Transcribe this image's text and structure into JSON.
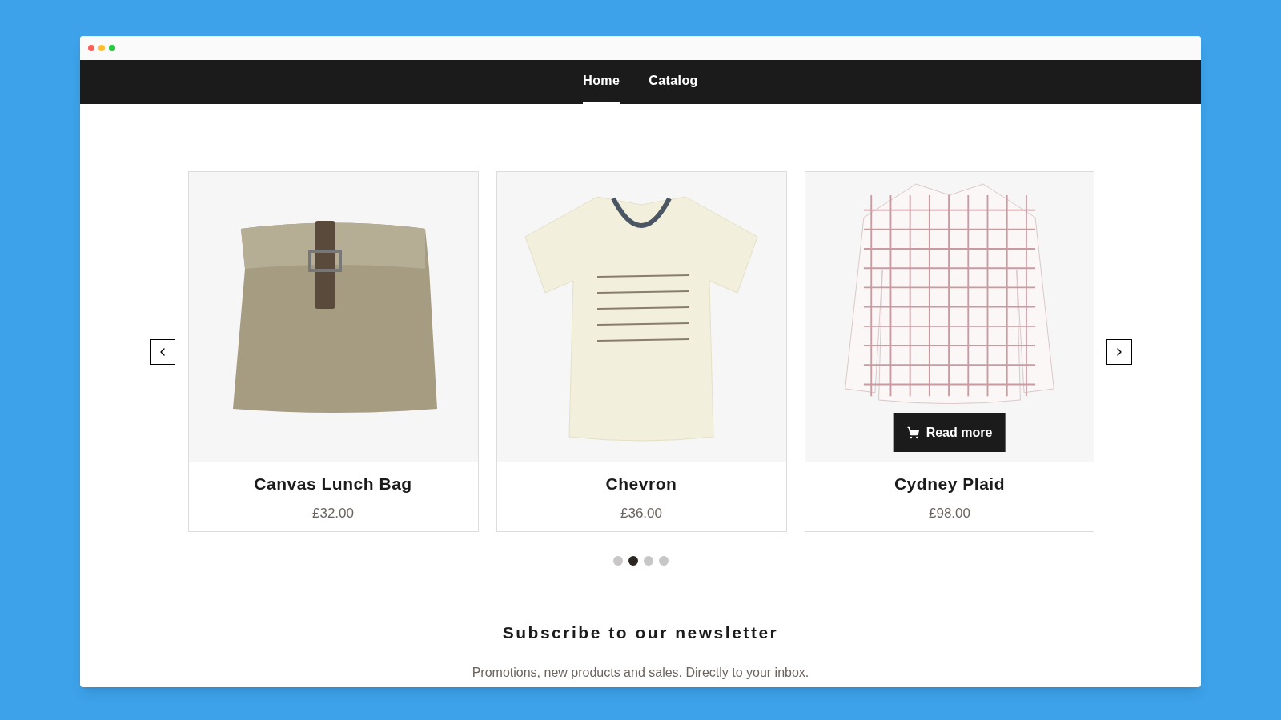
{
  "nav": [
    {
      "label": "Home",
      "selected": true
    },
    {
      "label": "Catalog",
      "selected": false
    }
  ],
  "products": [
    {
      "name": "Canvas Lunch Bag",
      "price": "£32.00",
      "kind": "bag"
    },
    {
      "name": "Chevron",
      "price": "£36.00",
      "kind": "tshirt"
    },
    {
      "name": "Cydney Plaid",
      "price": "£98.00",
      "kind": "shirt",
      "button": "Read more"
    }
  ],
  "dots": [
    {
      "selected": false
    },
    {
      "selected": true
    },
    {
      "selected": false
    },
    {
      "selected": false
    }
  ],
  "newsletter": {
    "title": "Subscribe to our newsletter",
    "text": "Promotions, new products and sales. Directly to your inbox."
  }
}
